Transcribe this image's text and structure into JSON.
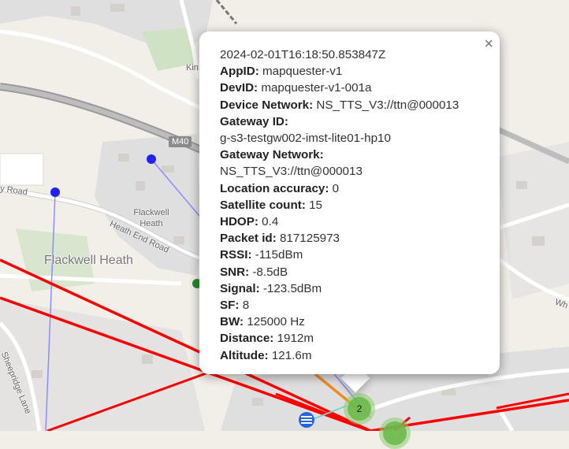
{
  "map": {
    "labels": {
      "motorway": "M40",
      "heath_end_road": "Heath End Road",
      "flackwell_heath_small": "Flackwell Heath",
      "flackwell_heath_large": "Flackwell Heath",
      "road_partial": "y Road",
      "sheepridge_lane": "Sheepridge Lane",
      "kin_partial": "Kin",
      "wh_partial": "Wh"
    },
    "clusters": [
      {
        "count": "2",
        "color": "#6ab945"
      },
      {
        "count": "",
        "color": "#6ab945"
      }
    ],
    "colors": {
      "link_red": "#ff0000",
      "link_blue": "#8c8cff",
      "marker_blue": "#2222ee",
      "link_orange": "#f08c1e"
    }
  },
  "popup": {
    "close_label": "×",
    "timestamp": "2024-02-01T16:18:50.853847Z",
    "fields": [
      {
        "label": "AppID:",
        "value": " mapquester-v1"
      },
      {
        "label": "DevID:",
        "value": " mapquester-v1-001a"
      },
      {
        "label": "Device Network:",
        "value": " NS_TTS_V3://ttn@000013"
      },
      {
        "label": "Gateway ID:",
        "value": ""
      },
      {
        "label": "",
        "value": "g-s3-testgw002-imst-lite01-hp10"
      },
      {
        "label": "Gateway Network:",
        "value": ""
      },
      {
        "label": "",
        "value": "NS_TTS_V3://ttn@000013"
      },
      {
        "label": "Location accuracy:",
        "value": " 0"
      },
      {
        "label": "Satellite count:",
        "value": " 15"
      },
      {
        "label": "HDOP:",
        "value": " 0.4"
      },
      {
        "label": "Packet id:",
        "value": " 817125973"
      },
      {
        "label": "RSSI:",
        "value": " -115dBm"
      },
      {
        "label": "SNR:",
        "value": " -8.5dB"
      },
      {
        "label": "Signal:",
        "value": " -123.5dBm"
      },
      {
        "label": "SF:",
        "value": " 8"
      },
      {
        "label": "BW:",
        "value": " 125000 Hz"
      },
      {
        "label": "Distance:",
        "value": " 1912m"
      },
      {
        "label": "Altitude:",
        "value": " 121.6m"
      }
    ]
  }
}
